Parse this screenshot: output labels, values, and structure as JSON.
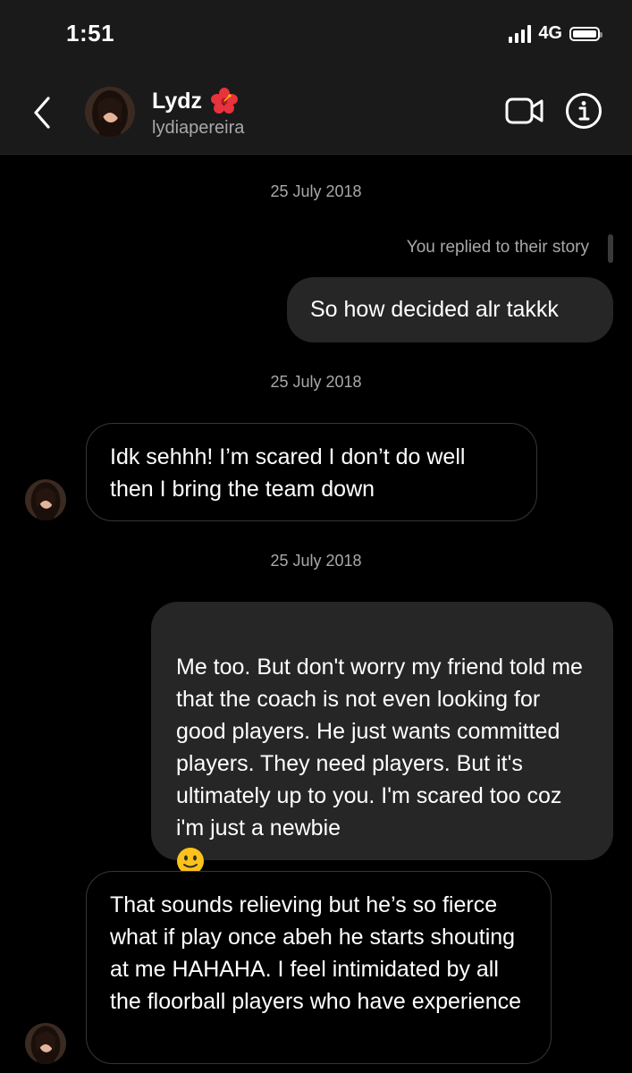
{
  "status_bar": {
    "time": "1:51",
    "network": "4G"
  },
  "header": {
    "name": "Lydz",
    "name_emoji": "hibiscus-icon",
    "handle": "lydiapereira"
  },
  "conversation": {
    "story_reply_note": "You replied to their story",
    "messages": [
      {
        "type": "date",
        "text": "25 July 2018"
      },
      {
        "type": "outgoing",
        "text": "So how decided alr takkk"
      },
      {
        "type": "date",
        "text": "25 July 2018"
      },
      {
        "type": "incoming",
        "text": "Idk sehhh! I’m scared I don’t do well then I bring the team down"
      },
      {
        "type": "date",
        "text": "25 July 2018"
      },
      {
        "type": "outgoing",
        "text": "Me too. But don't worry my friend told me that the coach is not even looking for good players. He just wants committed players. They need players. But it's ultimately up to you. I'm scared too coz i'm just a newbie",
        "emoji": "slightly-smiling-face-icon"
      },
      {
        "type": "incoming",
        "text": "That sounds relieving but he’s so fierce what if play once abeh he starts shouting at me HAHAHA. I feel intimidated by all the floorball players who have experience"
      }
    ]
  },
  "colors": {
    "background": "#000000",
    "header_background": "#1a1a1a",
    "outgoing_bubble": "#262626",
    "incoming_border": "#363636",
    "secondary_text": "#a8a8a8"
  }
}
